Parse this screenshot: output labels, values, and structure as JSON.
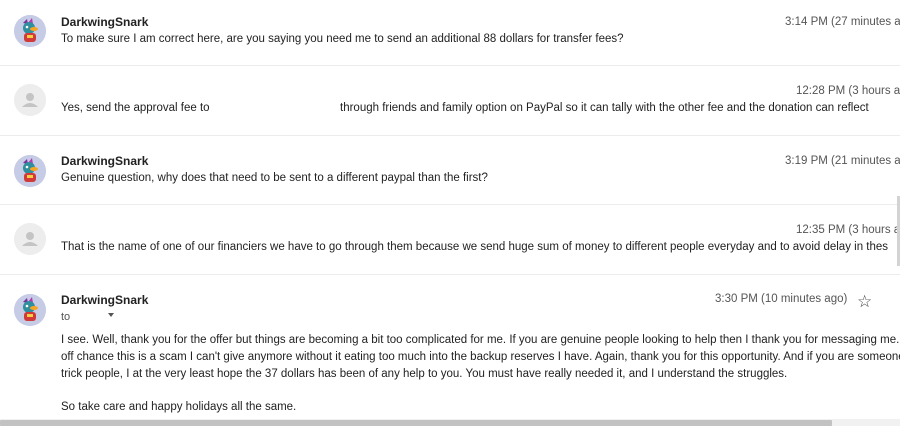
{
  "messages": [
    {
      "sender": "DarkwingSnark",
      "time": "3:14 PM (27 minutes a",
      "snippet": "To make sure I am correct here, are you saying you need me to send an additional 88 dollars for transfer fees?"
    },
    {
      "sender": "",
      "time": "12:28 PM (3 hours a",
      "snippet_part1": "Yes, send the approval fee to",
      "snippet_part2": "through friends and family option on PayPal so it can tally with the other fee and the donation can reflect"
    },
    {
      "sender": "DarkwingSnark",
      "time": "3:19 PM (21 minutes a",
      "snippet": "Genuine question, why does that need to be sent to a different paypal than the first?"
    },
    {
      "sender": "",
      "time": "12:35 PM (3 hours a",
      "snippet": "That is the name of one of our financiers we have to go through them because we send huge sum of money to different people everyday and to avoid delay in thes"
    },
    {
      "sender": "DarkwingSnark",
      "time": "3:30 PM (10 minutes ago)",
      "to_label": "to",
      "body_lines": [
        "I see. Well, thank you for the offer but things are becoming a bit too complicated for me. If you are genuine people looking to help then I thank you for messaging me. Bu",
        "off chance this is a scam I can't give anymore without it eating too much into the backup reserves I have. Again, thank you for this opportunity. And if you are someone tr",
        "trick people, I at the very least hope the 37 dollars has been of any help to you. You must have really needed it, and I understand the struggles."
      ],
      "closing": "So take care and happy holidays all the same."
    }
  ],
  "icons": {
    "star": "star-outline",
    "caret": "chevron-down",
    "default_avatar": "person-silhouette",
    "user_avatar": "cartoon-duck"
  },
  "colors": {
    "divider": "#ececec",
    "default_avatar_bg": "#ededed",
    "default_avatar_fg": "#c4c4c4",
    "user_avatar_bg": "#c6cbe6"
  }
}
